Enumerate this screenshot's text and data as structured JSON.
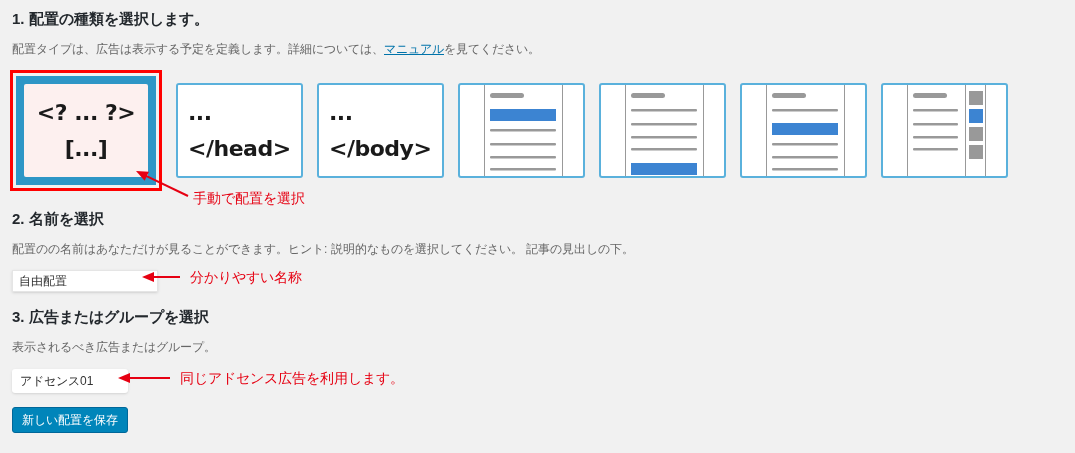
{
  "sections": [
    {
      "heading": "1. 配置の種類を選択します。",
      "description": "配置タイプは、広告は表示する予定を定義します。詳細については、",
      "link": "マニュアル",
      "description_end": "を見てください。"
    },
    {
      "heading": "2. 名前を選択",
      "description": "配置のの名前はあなただけが見ることができます。ヒント: 説明的なものを選択してください。 記事の見出しの下。"
    },
    {
      "heading": "3. 広告またはグループを選択",
      "description": "表示されるべき広告またはグループ。"
    }
  ],
  "placement_types": [
    {
      "kind": "code",
      "lines": [
        "<? ... ?>",
        "[...]"
      ],
      "selected": true
    },
    {
      "kind": "code",
      "lines": [
        "...",
        "</head>"
      ],
      "selected": false
    },
    {
      "kind": "code",
      "lines": [
        "...",
        "</body>"
      ],
      "selected": false
    },
    {
      "kind": "top",
      "selected": false
    },
    {
      "kind": "bottom",
      "selected": false
    },
    {
      "kind": "middle",
      "selected": false
    },
    {
      "kind": "sidebar",
      "selected": false
    }
  ],
  "name_field": {
    "value": "自由配置"
  },
  "ad_select": {
    "value": "アドセンス01"
  },
  "save_button": "新しい配置を保存",
  "annotations": [
    {
      "text": "手動で配置を選択"
    },
    {
      "text": "分かりやすい名称"
    },
    {
      "text": "同じアドセンス広告を利用します。"
    }
  ]
}
